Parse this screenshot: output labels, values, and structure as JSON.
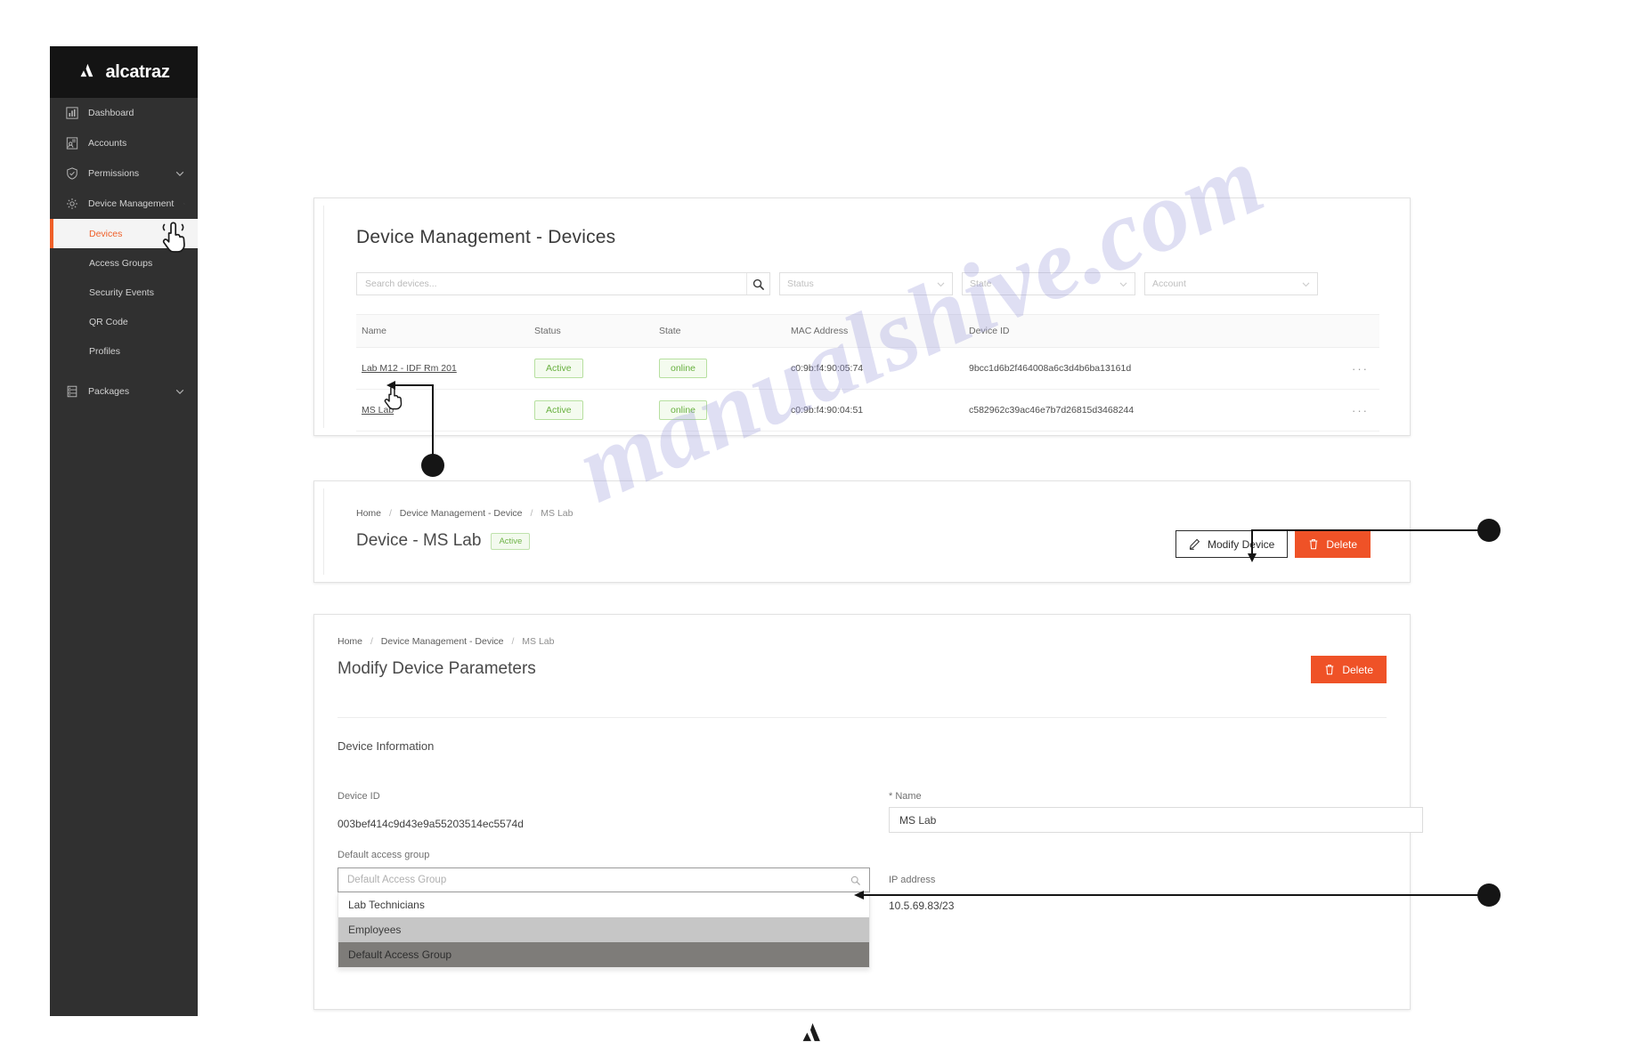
{
  "watermark": "manualshive.com",
  "brand": {
    "name": "alcatraz",
    "logo_icon": "alcatraz-logo-icon"
  },
  "sidebar": {
    "items": [
      {
        "label": "Dashboard",
        "icon": "chart-bar-icon",
        "chevron": ""
      },
      {
        "label": "Accounts",
        "icon": "account-id-icon",
        "chevron": ""
      },
      {
        "label": "Permissions",
        "icon": "shield-check-icon",
        "chevron": "chevron-down-icon"
      },
      {
        "label": "Device Management",
        "icon": "gear-icon",
        "chevron": "chevron-up-icon"
      }
    ],
    "sub_items": [
      {
        "label": "Devices",
        "active": true
      },
      {
        "label": "Access Groups",
        "active": false
      },
      {
        "label": "Security Events",
        "active": false
      },
      {
        "label": "QR Code",
        "active": false
      },
      {
        "label": "Profiles",
        "active": false
      }
    ],
    "bottom_items": [
      {
        "label": "Packages",
        "icon": "server-stack-icon",
        "chevron": "chevron-down-icon"
      }
    ]
  },
  "devices_panel": {
    "title": "Device Management - Devices",
    "search": {
      "placeholder": "Search devices...",
      "value": "",
      "icon": "search-icon"
    },
    "filters": [
      {
        "name": "status-filter",
        "placeholder": "Status"
      },
      {
        "name": "state-filter",
        "placeholder": "State"
      },
      {
        "name": "account-filter",
        "placeholder": "Account"
      }
    ],
    "columns": [
      "Name",
      "Status",
      "State",
      "MAC Address",
      "Device ID"
    ],
    "rows": [
      {
        "name": "Lab M12 - IDF Rm 201",
        "status": "Active",
        "state": "online",
        "mac": "c0:9b:f4:90:05:74",
        "device_id": "9bcc1d6b2f464008a6c3d4b6ba13161d",
        "more": "···"
      },
      {
        "name": "MS Lab",
        "status": "Active",
        "state": "online",
        "mac": "c0:9b:f4:90:04:51",
        "device_id": "c582962c39ac46e7b7d26815d3468244",
        "more": "···"
      }
    ]
  },
  "device_header_panel": {
    "breadcrumb": {
      "home": "Home",
      "section": "Device Management - Device",
      "current": "MS Lab",
      "separator": "/"
    },
    "title": "Device - MS Lab",
    "status_badge": "Active",
    "modify_button": {
      "label": "Modify Device",
      "icon": "pencil-icon"
    },
    "delete_button": {
      "label": "Delete",
      "icon": "trash-icon"
    }
  },
  "modify_panel": {
    "breadcrumb": {
      "home": "Home",
      "section": "Device Management - Device",
      "current": "MS Lab",
      "separator": "/"
    },
    "title": "Modify Device Parameters",
    "delete_button": {
      "label": "Delete",
      "icon": "trash-icon"
    },
    "section_title": "Device Information",
    "device_id": {
      "label": "Device ID",
      "value": "003bef414c9d43e9a55203514ec5574d"
    },
    "name": {
      "label": "* Name",
      "value": "MS Lab"
    },
    "default_access_group": {
      "label": "Default access group",
      "placeholder": "Default Access Group",
      "value": "",
      "icon": "search-icon",
      "options": [
        {
          "label": "Lab Technicians",
          "state": "normal"
        },
        {
          "label": "Employees",
          "state": "hover"
        },
        {
          "label": "Default Access Group",
          "state": "selected"
        }
      ]
    },
    "ip_address": {
      "label": "IP address",
      "value": "10.5.69.83/23"
    }
  },
  "colors": {
    "accent": "#ef5227",
    "sidebar_bg": "#303030",
    "brand_bg": "#141414",
    "success": "#68b03f"
  }
}
